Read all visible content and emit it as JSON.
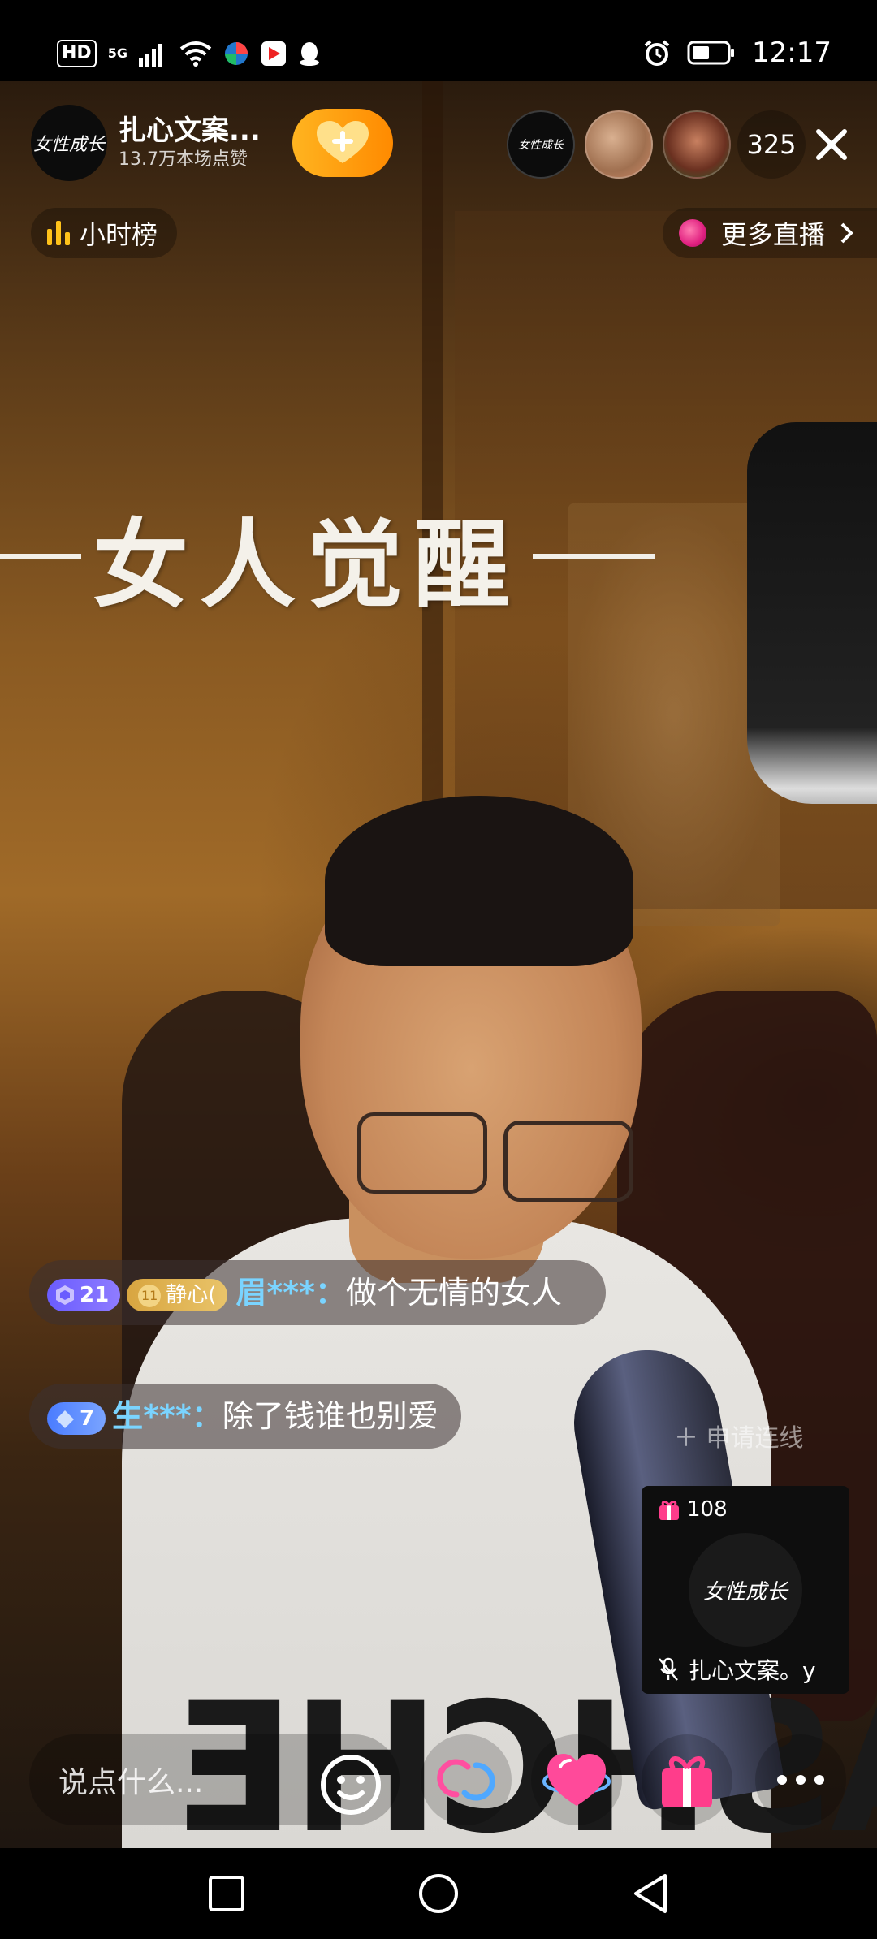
{
  "status_bar": {
    "hd": "HD",
    "network": "5G",
    "time": "12:17"
  },
  "host": {
    "avatar_text": "女性成长",
    "name": "扎心文案...",
    "likes": "13.7万本场点赞"
  },
  "viewers": {
    "avatar_1_text": "女性成长",
    "count": "325"
  },
  "hour_rank": {
    "label": "小时榜"
  },
  "more_live": {
    "label": "更多直播"
  },
  "video": {
    "title": "女人觉醒",
    "shirt_text": "ASHCHE"
  },
  "comments": [
    {
      "level": "21",
      "fan_level": "11",
      "fan_badge": "静心(",
      "user": "眉***：",
      "text": "做个无情的女人"
    },
    {
      "level": "7",
      "user": "生***：",
      "text": "除了钱谁也别爱"
    }
  ],
  "apply_link": {
    "label": "申请连线"
  },
  "mini_window": {
    "gift_count": "108",
    "avatar_text": "女性成长",
    "name": "扎心文案。y"
  },
  "bottom": {
    "input_placeholder": "说点什么..."
  },
  "colors": {
    "follow_gradient_start": "#ffb420",
    "follow_gradient_end": "#ff8a00",
    "comment_user": "#7ad4ff",
    "gift_pink": "#ff3d8b"
  }
}
